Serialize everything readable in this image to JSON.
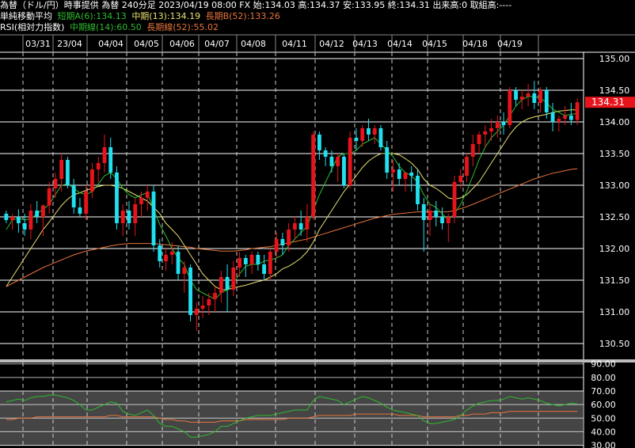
{
  "header": {
    "line1": "為替（ドル/円）時事提供 為替 240分足 2023/04/19 08:00 FX 始:134.03 高:134.37 安:133.95 終:134.31 出来高:0 取組高:----",
    "ma_title": "単純移動平均",
    "ma_short": "短期A(6):134.13",
    "ma_mid": "中期(13):134.19",
    "ma_long": "長期B(52):133.26",
    "rsi_title": "RSI(相対力指数)",
    "rsi_mid": "中期線(14):60.50",
    "rsi_long": "長期線(52):55.02"
  },
  "colors": {
    "up": "#e8141c",
    "down": "#22e0f0",
    "ma_short": "#2dbb2d",
    "ma_mid": "#e8e070",
    "ma_long": "#e8743c",
    "price_tag": "#e8141c",
    "rsi_band": "#6a6a6a"
  },
  "chart_data": [
    {
      "type": "candlestick",
      "x": [
        "03/31",
        "23/04",
        "04/04",
        "04/05",
        "04/06",
        "04/07",
        "04/08",
        "04/11",
        "04/12",
        "04/13",
        "04/14",
        "04/15",
        "04/18",
        "04/19"
      ],
      "yticks": [
        130.5,
        131.0,
        131.5,
        132.0,
        132.5,
        133.0,
        133.5,
        134.0,
        134.5,
        135.0
      ],
      "ylim": [
        130.25,
        135.1
      ],
      "last_price": "134.31",
      "ohlc": [
        [
          132.55,
          132.6,
          132.4,
          132.45
        ],
        [
          132.45,
          132.55,
          132.3,
          132.5
        ],
        [
          132.5,
          132.62,
          132.25,
          132.4
        ],
        [
          132.4,
          132.55,
          132.2,
          132.3
        ],
        [
          132.3,
          132.7,
          132.15,
          132.6
        ],
        [
          132.6,
          132.75,
          132.4,
          132.5
        ],
        [
          132.5,
          132.7,
          132.2,
          132.68
        ],
        [
          132.68,
          133.05,
          132.55,
          132.95
        ],
        [
          132.95,
          133.2,
          132.8,
          133.1
        ],
        [
          133.1,
          133.5,
          132.9,
          133.4
        ],
        [
          133.4,
          133.45,
          132.95,
          133.0
        ],
        [
          133.0,
          133.1,
          132.55,
          132.65
        ],
        [
          132.65,
          132.8,
          132.5,
          132.55
        ],
        [
          132.55,
          133.0,
          132.45,
          132.9
        ],
        [
          132.9,
          133.35,
          132.8,
          133.25
        ],
        [
          133.25,
          133.45,
          133.05,
          133.35
        ],
        [
          133.35,
          133.8,
          133.2,
          133.6
        ],
        [
          133.6,
          133.75,
          133.1,
          133.2
        ],
        [
          133.2,
          133.3,
          132.3,
          132.4
        ],
        [
          132.4,
          132.7,
          132.2,
          132.6
        ],
        [
          132.6,
          132.75,
          132.3,
          132.4
        ],
        [
          132.4,
          132.8,
          132.2,
          132.7
        ],
        [
          132.7,
          132.9,
          132.5,
          132.8
        ],
        [
          132.8,
          133.0,
          132.6,
          132.9
        ],
        [
          132.9,
          133.0,
          131.95,
          132.05
        ],
        [
          132.05,
          132.15,
          131.7,
          131.8
        ],
        [
          131.8,
          132.0,
          131.65,
          131.9
        ],
        [
          131.9,
          132.1,
          131.75,
          131.95
        ],
        [
          131.95,
          132.05,
          131.5,
          131.6
        ],
        [
          131.6,
          131.8,
          131.3,
          131.7
        ],
        [
          131.7,
          131.75,
          130.85,
          130.95
        ],
        [
          130.95,
          131.15,
          130.7,
          131.05
        ],
        [
          131.05,
          131.25,
          130.9,
          131.1
        ],
        [
          131.1,
          131.3,
          130.95,
          131.2
        ],
        [
          131.2,
          131.4,
          131.0,
          131.3
        ],
        [
          131.3,
          131.65,
          131.15,
          131.55
        ],
        [
          131.55,
          131.75,
          131.0,
          131.35
        ],
        [
          131.35,
          131.8,
          131.25,
          131.7
        ],
        [
          131.7,
          131.95,
          131.55,
          131.85
        ],
        [
          131.85,
          131.9,
          131.55,
          131.75
        ],
        [
          131.75,
          131.95,
          131.6,
          131.9
        ],
        [
          131.9,
          131.95,
          131.65,
          131.75
        ],
        [
          131.75,
          131.9,
          131.5,
          131.6
        ],
        [
          131.6,
          132.0,
          131.5,
          131.95
        ],
        [
          131.95,
          132.25,
          131.85,
          132.15
        ],
        [
          132.15,
          132.25,
          131.9,
          132.05
        ],
        [
          132.05,
          132.4,
          131.95,
          132.3
        ],
        [
          132.3,
          132.5,
          132.15,
          132.4
        ],
        [
          132.4,
          132.6,
          132.2,
          132.3
        ],
        [
          132.3,
          132.7,
          132.1,
          132.5
        ],
        [
          132.5,
          133.85,
          132.45,
          133.8
        ],
        [
          133.8,
          133.85,
          133.4,
          133.55
        ],
        [
          133.55,
          133.6,
          133.3,
          133.45
        ],
        [
          133.45,
          133.55,
          133.2,
          133.3
        ],
        [
          133.3,
          133.5,
          133.05,
          133.45
        ],
        [
          133.45,
          133.5,
          132.95,
          133.0
        ],
        [
          133.0,
          133.85,
          132.95,
          133.75
        ],
        [
          133.75,
          133.9,
          133.55,
          133.7
        ],
        [
          133.7,
          133.95,
          133.6,
          133.9
        ],
        [
          133.9,
          134.05,
          133.7,
          133.8
        ],
        [
          133.8,
          133.95,
          133.65,
          133.9
        ],
        [
          133.9,
          133.95,
          133.55,
          133.6
        ],
        [
          133.6,
          133.7,
          133.1,
          133.2
        ],
        [
          133.2,
          133.4,
          132.9,
          133.25
        ],
        [
          133.25,
          133.35,
          133.0,
          133.1
        ],
        [
          133.1,
          133.2,
          132.9,
          133.2
        ],
        [
          133.2,
          133.3,
          132.9,
          133.15
        ],
        [
          133.15,
          133.25,
          132.6,
          132.7
        ],
        [
          132.7,
          132.8,
          131.95,
          132.45
        ],
        [
          132.45,
          132.7,
          132.2,
          132.6
        ],
        [
          132.6,
          132.75,
          132.35,
          132.5
        ],
        [
          132.5,
          132.65,
          132.3,
          132.4
        ],
        [
          132.4,
          132.55,
          132.1,
          132.5
        ],
        [
          132.5,
          133.15,
          132.4,
          133.05
        ],
        [
          133.05,
          133.25,
          132.95,
          133.15
        ],
        [
          133.15,
          133.5,
          133.05,
          133.45
        ],
        [
          133.45,
          133.8,
          133.3,
          133.65
        ],
        [
          133.65,
          133.85,
          133.5,
          133.8
        ],
        [
          133.8,
          133.95,
          133.6,
          133.85
        ],
        [
          133.85,
          134.05,
          133.7,
          133.9
        ],
        [
          133.9,
          134.1,
          133.75,
          134.0
        ],
        [
          134.0,
          134.15,
          133.8,
          133.95
        ],
        [
          133.95,
          134.55,
          133.9,
          134.5
        ],
        [
          134.5,
          134.55,
          134.25,
          134.35
        ],
        [
          134.35,
          134.5,
          134.2,
          134.4
        ],
        [
          134.4,
          134.6,
          134.25,
          134.45
        ],
        [
          134.45,
          134.65,
          134.2,
          134.3
        ],
        [
          134.3,
          134.55,
          134.15,
          134.5
        ],
        [
          134.5,
          134.55,
          134.05,
          134.15
        ],
        [
          134.15,
          134.3,
          133.85,
          134.0
        ],
        [
          134.0,
          134.1,
          133.85,
          134.05
        ],
        [
          134.05,
          134.25,
          133.95,
          134.1
        ],
        [
          134.1,
          134.3,
          133.95,
          134.03
        ],
        [
          134.03,
          134.37,
          133.95,
          134.31
        ]
      ],
      "ma_short": [
        132.3,
        132.45,
        132.48,
        132.45,
        132.47,
        132.55,
        132.62,
        132.7,
        132.85,
        133.0,
        133.02,
        132.95,
        132.88,
        132.85,
        132.9,
        133.02,
        133.15,
        133.2,
        133.1,
        132.95,
        132.85,
        132.8,
        132.85,
        132.88,
        132.62,
        132.38,
        132.2,
        132.0,
        131.85,
        131.75,
        131.5,
        131.35,
        131.3,
        131.25,
        131.2,
        131.3,
        131.35,
        131.45,
        131.6,
        131.72,
        131.75,
        131.75,
        131.8,
        131.82,
        131.85,
        131.9,
        132.05,
        132.15,
        132.25,
        132.35,
        132.6,
        132.85,
        133.05,
        133.25,
        133.45,
        133.5,
        133.5,
        133.55,
        133.65,
        133.7,
        133.75,
        133.65,
        133.55,
        133.45,
        133.3,
        133.2,
        133.15,
        133.05,
        132.85,
        132.7,
        132.65,
        132.55,
        132.45,
        132.55,
        132.7,
        132.9,
        133.15,
        133.4,
        133.6,
        133.75,
        133.85,
        133.95,
        134.1,
        134.25,
        134.35,
        134.4,
        134.4,
        134.38,
        134.3,
        134.2,
        134.15,
        134.1,
        134.12,
        134.13
      ],
      "ma_mid": [
        131.4,
        131.55,
        131.7,
        131.85,
        132.0,
        132.15,
        132.3,
        132.42,
        132.55,
        132.68,
        132.78,
        132.85,
        132.88,
        132.92,
        132.95,
        132.98,
        133.0,
        133.0,
        132.98,
        132.95,
        132.9,
        132.85,
        132.8,
        132.75,
        132.65,
        132.55,
        132.4,
        132.3,
        132.2,
        132.05,
        131.9,
        131.75,
        131.6,
        131.5,
        131.4,
        131.35,
        131.35,
        131.38,
        131.4,
        131.42,
        131.45,
        131.48,
        131.5,
        131.55,
        131.6,
        131.68,
        131.72,
        131.78,
        131.85,
        131.95,
        132.1,
        132.3,
        132.45,
        132.6,
        132.75,
        132.9,
        133.02,
        133.15,
        133.28,
        133.38,
        133.45,
        133.5,
        133.5,
        133.5,
        133.48,
        133.42,
        133.35,
        133.25,
        133.1,
        133.0,
        132.95,
        132.88,
        132.8,
        132.78,
        132.8,
        132.85,
        132.95,
        133.05,
        133.2,
        133.35,
        133.5,
        133.65,
        133.8,
        133.92,
        134.0,
        134.05,
        134.08,
        134.1,
        134.12,
        134.15,
        134.17,
        134.18,
        134.19,
        134.19
      ],
      "ma_long": [
        131.4,
        131.45,
        131.5,
        131.55,
        131.6,
        131.65,
        131.7,
        131.74,
        131.78,
        131.82,
        131.86,
        131.9,
        131.93,
        131.96,
        131.98,
        132.0,
        132.02,
        132.04,
        132.06,
        132.07,
        132.08,
        132.08,
        132.08,
        132.08,
        132.08,
        132.07,
        132.06,
        132.05,
        132.04,
        132.03,
        132.02,
        132.0,
        131.99,
        131.98,
        131.97,
        131.96,
        131.96,
        131.96,
        131.97,
        131.98,
        132.0,
        132.01,
        132.02,
        132.03,
        132.05,
        132.07,
        132.09,
        132.11,
        132.13,
        132.15,
        132.18,
        132.21,
        132.24,
        132.27,
        132.3,
        132.33,
        132.36,
        132.39,
        132.42,
        132.45,
        132.48,
        132.5,
        132.52,
        132.54,
        132.55,
        132.56,
        132.57,
        132.58,
        132.58,
        132.58,
        132.58,
        132.58,
        132.58,
        132.6,
        132.63,
        132.66,
        132.7,
        132.74,
        132.78,
        132.82,
        132.86,
        132.9,
        132.94,
        132.98,
        133.02,
        133.06,
        133.1,
        133.13,
        133.16,
        133.19,
        133.21,
        133.23,
        133.25,
        133.26
      ]
    },
    {
      "type": "line",
      "title": "RSI",
      "yticks": [
        30.0,
        40.0,
        50.0,
        60.0,
        70.0,
        80.0,
        90.0
      ],
      "ylim": [
        28,
        91
      ],
      "band": [
        30,
        70
      ],
      "rsi_mid": [
        62,
        63,
        64,
        63,
        65,
        66,
        66,
        67,
        67,
        66,
        65,
        63,
        60,
        56,
        56,
        58,
        60,
        62,
        61,
        55,
        53,
        52,
        54,
        56,
        52,
        46,
        44,
        44,
        42,
        40,
        36,
        36,
        37,
        38,
        40,
        44,
        44,
        46,
        48,
        50,
        51,
        52,
        52,
        52,
        53,
        54,
        55,
        56,
        56,
        56,
        63,
        66,
        65,
        64,
        63,
        60,
        62,
        64,
        66,
        65,
        63,
        61,
        58,
        56,
        55,
        54,
        53,
        52,
        48,
        46,
        46,
        47,
        48,
        49,
        52,
        56,
        59,
        61,
        62,
        63,
        63,
        64,
        66,
        65,
        64,
        65,
        64,
        63,
        61,
        60,
        59,
        60,
        61,
        60.5
      ],
      "rsi_long": [
        49,
        49,
        50,
        50,
        50,
        51,
        51,
        51,
        51,
        51,
        51,
        51,
        51,
        51,
        51,
        51,
        51,
        52,
        52,
        51,
        51,
        51,
        51,
        51,
        51,
        50,
        49,
        49,
        48,
        48,
        47,
        47,
        47,
        47,
        47,
        48,
        48,
        48,
        48,
        49,
        49,
        49,
        49,
        49,
        49,
        49,
        50,
        50,
        50,
        50,
        51,
        52,
        52,
        52,
        52,
        52,
        52,
        53,
        53,
        53,
        53,
        53,
        53,
        53,
        52,
        52,
        52,
        52,
        51,
        51,
        51,
        51,
        51,
        51,
        52,
        52,
        53,
        53,
        53,
        54,
        54,
        54,
        55,
        55,
        55,
        55,
        55,
        55,
        55,
        55,
        55,
        55,
        55,
        55.02
      ]
    }
  ]
}
